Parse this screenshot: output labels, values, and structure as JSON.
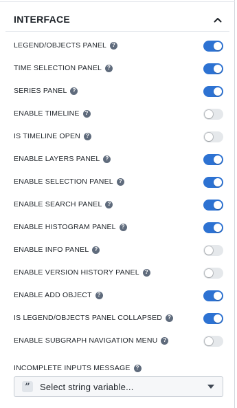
{
  "section": {
    "title": "INTERFACE",
    "collapse_icon": "chevron-up-icon"
  },
  "help_glyph": "?",
  "settings": [
    {
      "label": "LEGEND/OBJECTS PANEL",
      "enabled": true
    },
    {
      "label": "TIME SELECTION PANEL",
      "enabled": true
    },
    {
      "label": "SERIES PANEL",
      "enabled": true
    },
    {
      "label": "ENABLE TIMELINE",
      "enabled": false
    },
    {
      "label": "IS TIMELINE OPEN",
      "enabled": false
    },
    {
      "label": "ENABLE LAYERS PANEL",
      "enabled": true
    },
    {
      "label": "ENABLE SELECTION PANEL",
      "enabled": true
    },
    {
      "label": "ENABLE SEARCH PANEL",
      "enabled": true
    },
    {
      "label": "ENABLE HISTOGRAM PANEL",
      "enabled": true
    },
    {
      "label": "ENABLE INFO PANEL",
      "enabled": false
    },
    {
      "label": "ENABLE VERSION HISTORY PANEL",
      "enabled": false
    },
    {
      "label": "ENABLE ADD OBJECT",
      "enabled": true
    },
    {
      "label": "IS LEGEND/OBJECTS PANEL COLLAPSED",
      "enabled": true
    },
    {
      "label": "ENABLE SUBGRAPH NAVIGATION MENU",
      "enabled": false
    }
  ],
  "incomplete_inputs": {
    "label": "INCOMPLETE INPUTS MESSAGE",
    "badge": "”",
    "placeholder": "Select string variable..."
  },
  "colors": {
    "toggle_on": "#2d72d2",
    "toggle_off": "#e5e8eb",
    "text": "#1c2127"
  }
}
